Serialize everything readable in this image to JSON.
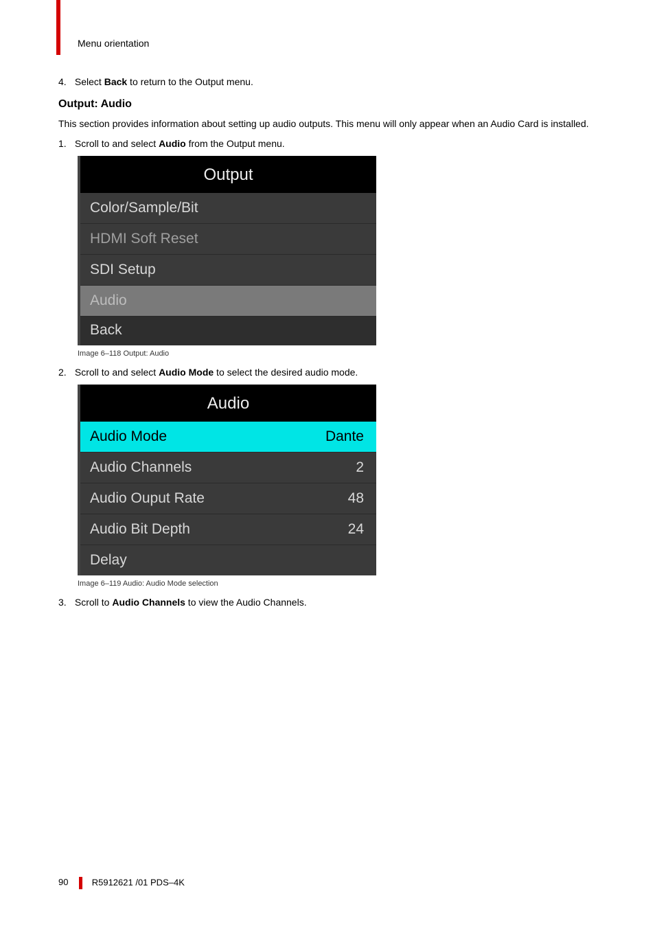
{
  "header": {
    "section": "Menu orientation"
  },
  "steps": {
    "s4": {
      "num": "4.",
      "prefix": "Select ",
      "bold": "Back",
      "suffix": " to return to the Output menu."
    }
  },
  "section": {
    "title": "Output: Audio",
    "intro": "This section provides information about setting up audio outputs. This menu will only appear when an Audio Card is installed."
  },
  "step1": {
    "num": "1.",
    "prefix": "Scroll to and select ",
    "bold": "Audio",
    "suffix": " from the Output menu."
  },
  "menu1": {
    "title": "Output",
    "rows": [
      {
        "label": "Color/Sample/Bit"
      },
      {
        "label": "HDMI Soft Reset"
      },
      {
        "label": "SDI Setup"
      },
      {
        "label": "Audio"
      },
      {
        "label": "Back"
      }
    ]
  },
  "caption1": "Image 6–118  Output: Audio",
  "step2": {
    "num": "2.",
    "prefix": "Scroll to and select ",
    "bold": "Audio Mode",
    "suffix": " to select the desired audio mode."
  },
  "menu2": {
    "title": "Audio",
    "rows": [
      {
        "label": "Audio Mode",
        "value": "Dante"
      },
      {
        "label": "Audio Channels",
        "value": "2"
      },
      {
        "label": "Audio Ouput Rate",
        "value": "48"
      },
      {
        "label": "Audio Bit Depth",
        "value": "24"
      },
      {
        "label": "Delay",
        "value": ""
      }
    ]
  },
  "caption2": "Image 6–119  Audio: Audio Mode selection",
  "step3": {
    "num": "3.",
    "prefix": "Scroll to ",
    "bold": "Audio Channels",
    "suffix": " to view the Audio Channels."
  },
  "footer": {
    "page": "90",
    "doc": "R5912621 /01 PDS–4K"
  },
  "chart_data": [
    {
      "type": "table",
      "title": "Output",
      "categories": [
        "Color/Sample/Bit",
        "HDMI Soft Reset",
        "SDI Setup",
        "Audio",
        "Back"
      ],
      "selected": "Audio"
    },
    {
      "type": "table",
      "title": "Audio",
      "series": [
        {
          "name": "Audio Mode",
          "values": [
            "Dante"
          ]
        },
        {
          "name": "Audio Channels",
          "values": [
            2
          ]
        },
        {
          "name": "Audio Ouput Rate",
          "values": [
            48
          ]
        },
        {
          "name": "Audio Bit Depth",
          "values": [
            24
          ]
        },
        {
          "name": "Delay",
          "values": [
            ""
          ]
        }
      ],
      "selected": "Audio Mode"
    }
  ]
}
